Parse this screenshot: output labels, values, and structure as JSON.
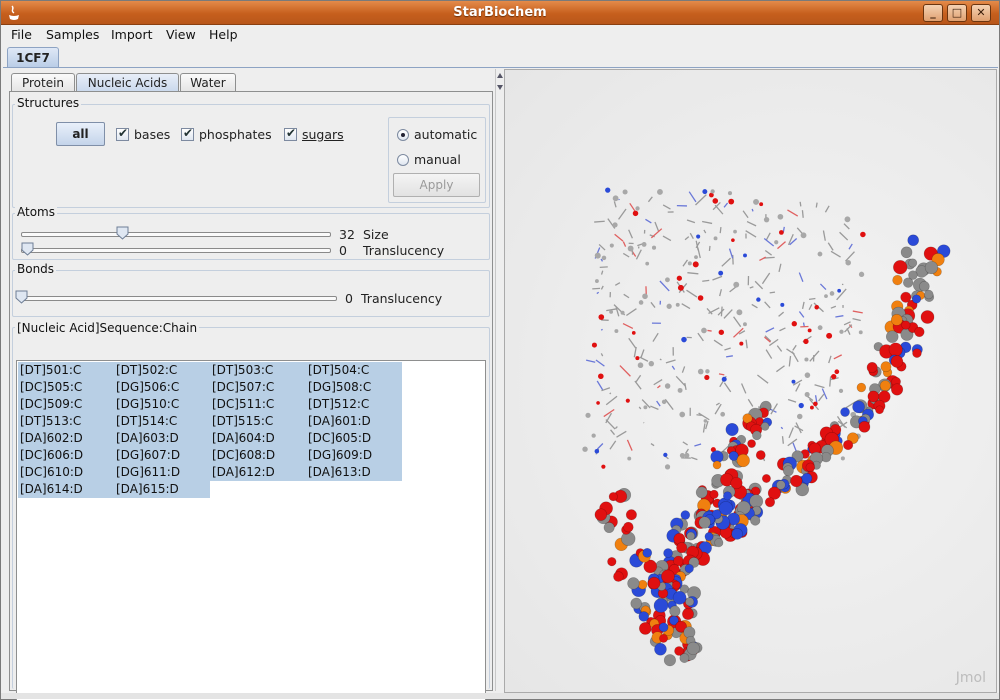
{
  "window": {
    "title": "StarBiochem",
    "minimize": "_",
    "maximize": "□",
    "close": "✕"
  },
  "menu": [
    "File",
    "Samples",
    "Import",
    "View",
    "Help"
  ],
  "doc_tab": "1CF7",
  "sub_tabs": [
    "Protein",
    "Nucleic Acids",
    "Water"
  ],
  "structures": {
    "title": "Structures",
    "all_button": "all",
    "bases": "bases",
    "phosphates": "phosphates",
    "sugars": "sugars",
    "automatic": "automatic",
    "manual": "manual",
    "apply": "Apply"
  },
  "atoms": {
    "title": "Atoms",
    "size_value": "32",
    "size_label": "Size",
    "size_level": 0.32,
    "translucency_value": "0",
    "translucency_label": "Translucency",
    "translucency_level": 0
  },
  "bonds": {
    "title": "Bonds",
    "translucency_value": "0",
    "translucency_label": "Translucency",
    "translucency_level": 0
  },
  "sequence": {
    "title": "[Nucleic Acid]Sequence:Chain",
    "items": [
      "[DT]501:C",
      "[DT]502:C",
      "[DT]503:C",
      "[DT]504:C",
      "[DC]505:C",
      "[DG]506:C",
      "[DC]507:C",
      "[DG]508:C",
      "[DC]509:C",
      "[DG]510:C",
      "[DC]511:C",
      "[DT]512:C",
      "[DT]513:C",
      "[DT]514:C",
      "[DT]515:C",
      "[DA]601:D",
      "[DA]602:D",
      "[DA]603:D",
      "[DA]604:D",
      "[DC]605:D",
      "[DC]606:D",
      "[DG]607:D",
      "[DC]608:D",
      "[DG]609:D",
      "[DC]610:D",
      "[DG]611:D",
      "[DA]612:D",
      "[DA]613:D",
      "[DA]614:D",
      "[DA]615:D"
    ]
  },
  "viewer": {
    "watermark": "Jmol"
  },
  "colors": {
    "title_bar": "#c65f1d",
    "selection": "#b8cfe5",
    "oxygen": "#e01010",
    "carbon": "#8a8a8a",
    "nitrogen": "#2a4ad8",
    "phosphorus": "#f08010"
  }
}
